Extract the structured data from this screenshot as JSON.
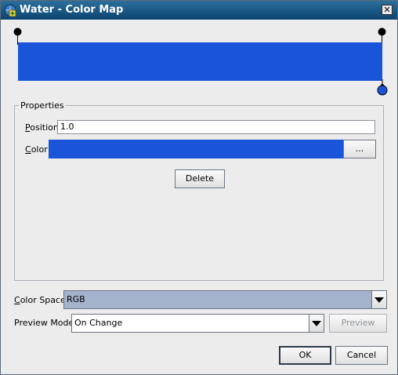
{
  "window": {
    "title": "Water - Color Map",
    "close_glyph": "✕",
    "icons": {
      "app": "app-plus-icon",
      "close": "close-icon"
    }
  },
  "gradient": {
    "color": "#1a54d8",
    "stops": [
      {
        "position": 0.0
      },
      {
        "position": 1.0,
        "selected": true
      }
    ]
  },
  "properties": {
    "group_label": "Properties",
    "position_label": "Position",
    "position_value": "1.0",
    "color_label": "Color",
    "color_value": "#1a54d8",
    "browse_label": "...",
    "delete_label": "Delete"
  },
  "color_space": {
    "label": "Color Space",
    "value": "RGB"
  },
  "preview_mode": {
    "label": "Preview Mode",
    "value": "On Change",
    "preview_button": "Preview"
  },
  "buttons": {
    "ok": "OK",
    "cancel": "Cancel"
  }
}
